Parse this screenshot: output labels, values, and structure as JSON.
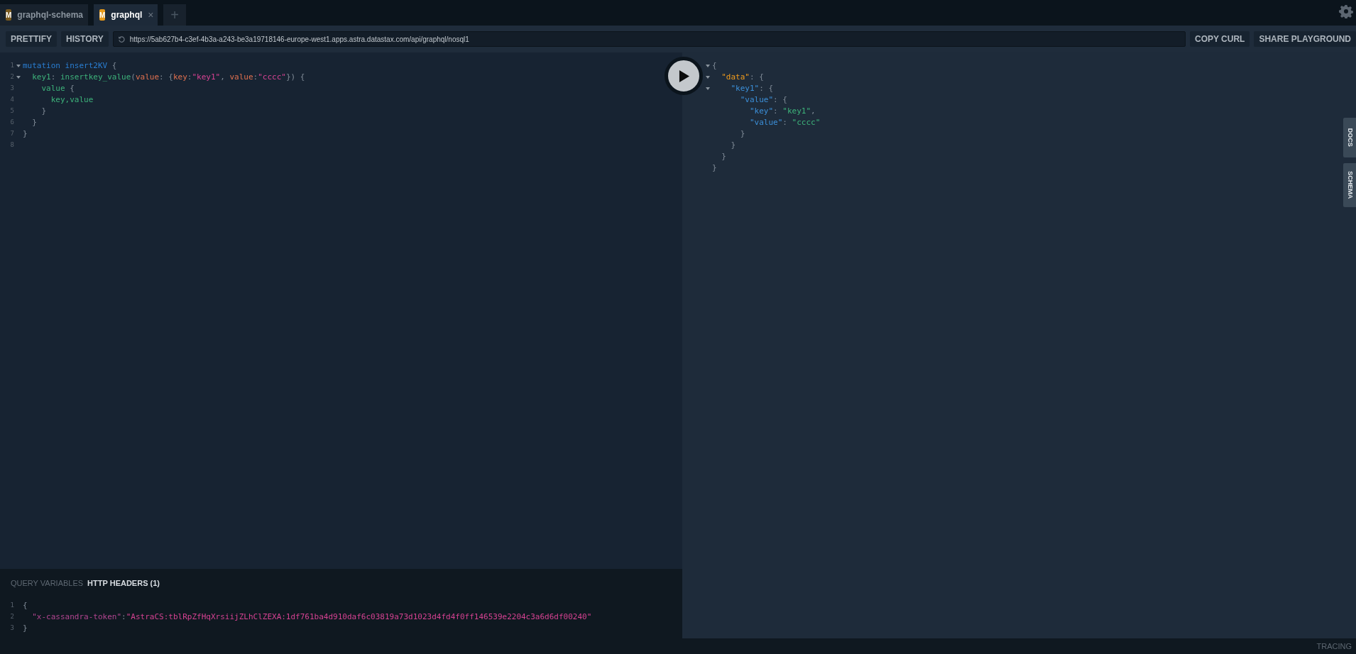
{
  "tabs": [
    {
      "label": "graphql-schema",
      "badge": "M",
      "selected": false
    },
    {
      "label": "graphql",
      "badge": "M",
      "selected": true,
      "close": "×"
    }
  ],
  "new_tab": "+",
  "toolbar": {
    "buttons_left": [
      "PRETTIFY",
      "HISTORY"
    ],
    "url": "https://5ab627b4-c3ef-4b3a-a243-be3a19718146-europe-west1.apps.astra.datastax.com/api/graphql/nosql1",
    "buttons_right": [
      "COPY CURL",
      "SHARE PLAYGROUND"
    ]
  },
  "editor": {
    "lines": [
      {
        "number": "1",
        "foldable": true,
        "tokens": [
          {
            "kind": "keyword",
            "text": "mutation"
          },
          {
            "kind": "def",
            "text": " insert2KV"
          },
          {
            "kind": "punct",
            "text": " {"
          }
        ]
      },
      {
        "number": "2",
        "foldable": true,
        "tokens": [
          {
            "kind": "field",
            "text": "  key1"
          },
          {
            "kind": "punct",
            "text": ": "
          },
          {
            "kind": "field",
            "text": "insertkey_value"
          },
          {
            "kind": "punct",
            "text": "("
          },
          {
            "kind": "attr",
            "text": "value"
          },
          {
            "kind": "punct",
            "text": ": {"
          },
          {
            "kind": "attr",
            "text": "key"
          },
          {
            "kind": "punct",
            "text": ":"
          },
          {
            "kind": "string",
            "text": "\"key1\""
          },
          {
            "kind": "punct",
            "text": ", "
          },
          {
            "kind": "attr",
            "text": "value"
          },
          {
            "kind": "punct",
            "text": ":"
          },
          {
            "kind": "string",
            "text": "\"cccc\""
          },
          {
            "kind": "punct",
            "text": "}) {"
          }
        ]
      },
      {
        "number": "3",
        "foldable": false,
        "tokens": [
          {
            "kind": "field",
            "text": "    value"
          },
          {
            "kind": "punct",
            "text": " {"
          }
        ]
      },
      {
        "number": "4",
        "foldable": false,
        "tokens": [
          {
            "kind": "field",
            "text": "      key,value"
          }
        ]
      },
      {
        "number": "5",
        "foldable": false,
        "tokens": [
          {
            "kind": "punct",
            "text": "    }"
          }
        ]
      },
      {
        "number": "6",
        "foldable": false,
        "tokens": [
          {
            "kind": "punct",
            "text": "  }"
          }
        ]
      },
      {
        "number": "7",
        "foldable": false,
        "tokens": [
          {
            "kind": "punct",
            "text": "}"
          }
        ]
      },
      {
        "number": "8",
        "foldable": false
      }
    ]
  },
  "result": {
    "lines": [
      {
        "foldable": true,
        "tokens": [
          {
            "kind": "punct",
            "text": "{"
          }
        ]
      },
      {
        "foldable": true,
        "tokens": [
          {
            "kind": "datakey",
            "text": "  \"data\""
          },
          {
            "kind": "punct",
            "text": ": {"
          }
        ]
      },
      {
        "foldable": true,
        "tokens": [
          {
            "kind": "key",
            "text": "    \"key1\""
          },
          {
            "kind": "punct",
            "text": ": {"
          }
        ]
      },
      {
        "foldable": false,
        "tokens": [
          {
            "kind": "key",
            "text": "      \"value\""
          },
          {
            "kind": "punct",
            "text": ": {"
          }
        ]
      },
      {
        "foldable": false,
        "tokens": [
          {
            "kind": "key",
            "text": "        \"key\""
          },
          {
            "kind": "punct",
            "text": ": "
          },
          {
            "kind": "jstring",
            "text": "\"key1\""
          },
          {
            "kind": "punct",
            "text": ","
          }
        ]
      },
      {
        "foldable": false,
        "tokens": [
          {
            "kind": "key",
            "text": "        \"value\""
          },
          {
            "kind": "punct",
            "text": ": "
          },
          {
            "kind": "jstring",
            "text": "\"cccc\""
          }
        ]
      },
      {
        "foldable": false,
        "tokens": [
          {
            "kind": "punct",
            "text": "      }"
          }
        ]
      },
      {
        "foldable": false,
        "tokens": [
          {
            "kind": "punct",
            "text": "    }"
          }
        ]
      },
      {
        "foldable": false,
        "tokens": [
          {
            "kind": "punct",
            "text": "  }"
          }
        ]
      },
      {
        "foldable": false,
        "tokens": [
          {
            "kind": "punct",
            "text": "}"
          }
        ]
      }
    ]
  },
  "side_tabs": [
    "DOCS",
    "SCHEMA"
  ],
  "bottom_panel": {
    "tabs": [
      {
        "label": "QUERY VARIABLES",
        "selected": false
      },
      {
        "label": "HTTP HEADERS (1)",
        "selected": true
      }
    ],
    "lines": [
      {
        "number": "1",
        "tokens": [
          {
            "kind": "punct",
            "text": "{"
          }
        ]
      },
      {
        "number": "2",
        "tokens": [
          {
            "kind": "hkey",
            "text": "  \"x-cassandra-token\""
          },
          {
            "kind": "punct",
            "text": ":"
          },
          {
            "kind": "string",
            "text": "\"AstraCS:tblRpZfHqXrsiijZLhClZEXA:1df761ba4d910daf6c03819a73d1023d4fd4f0ff146539e2204c3a6d6df00240\""
          }
        ]
      },
      {
        "number": "3",
        "tokens": [
          {
            "kind": "punct",
            "text": "}"
          }
        ]
      }
    ]
  },
  "footer": {
    "tracing": "TRACING"
  }
}
